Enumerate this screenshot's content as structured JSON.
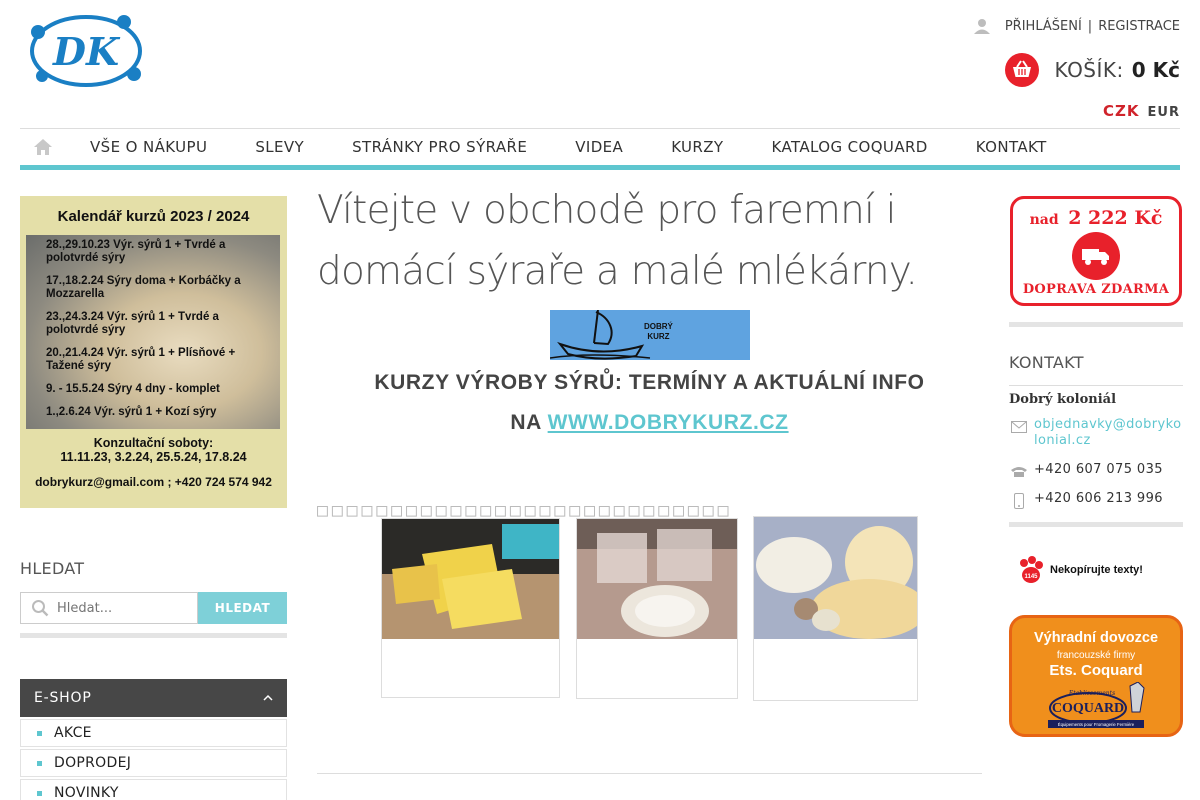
{
  "header": {
    "login": "PŘIHLÁŠENÍ",
    "register": "REGISTRACE",
    "cart_label": "KOŠÍK:",
    "cart_total": "0 Kč",
    "currency_active": "CZK",
    "currency_other": "EUR",
    "logo_text": "DK"
  },
  "nav": {
    "items": [
      "VŠE O NÁKUPU",
      "SLEVY",
      "STRÁNKY PRO SÝRAŘE",
      "VIDEA",
      "KURZY",
      "KATALOG COQUARD",
      "KONTAKT"
    ]
  },
  "calendar": {
    "title": "Kalendář kurzů 2023 / 2024",
    "lines": [
      "28.,29.10.23 Výr. sýrů 1 + Tvrdé a polotvrdé sýry",
      "17.,18.2.24 Sýry doma + Korbáčky a Mozzarella",
      "23.,24.3.24 Výr. sýrů 1 + Tvrdé a polotvrdé sýry",
      "20.,21.4.24 Výr. sýrů 1 + Plísňové + Tažené sýry",
      "9. - 15.5.24 Sýry 4 dny - komplet",
      "1.,2.6.24 Výr. sýrů 1 + Kozí sýry"
    ],
    "saturdays_title": "Konzultační soboty:",
    "saturdays_dates": "11.11.23, 3.2.24, 25.5.24, 17.8.24",
    "contact": "dobrykurz@gmail.com ; +420 724 574 942"
  },
  "search": {
    "heading": "HLEDAT",
    "placeholder": "Hledat...",
    "button": "HLEDAT"
  },
  "eshop": {
    "heading": "E-SHOP",
    "items": [
      "AKCE",
      "DOPRODEJ",
      "NOVINKY"
    ]
  },
  "main": {
    "welcome": "Vítejte v obchodě pro faremní i domácí sýraře a malé mlékárny.",
    "banner_text_1": "DOBRÝ",
    "banner_text_2": "KURZ",
    "kurzy_line1": "KURZY VÝROBY SÝRŮ: TERMÍNY A AKTUÁLNÍ INFO",
    "kurzy_line2_prefix": "NA",
    "kurzy_link": "WWW.DOBRYKURZ.CZ",
    "glyph_row": "□□□□□□□□□□□□□□□□□□□□□□□□□□□□"
  },
  "shipping": {
    "prefix": "nad",
    "amount": "2 222 Kč",
    "label": "DOPRAVA ZDARMA"
  },
  "contact": {
    "heading": "KONTAKT",
    "name": "Dobrý koloniál",
    "email": "objednavky@dobrykolonial.cz",
    "phone1": "+420 607 075 035",
    "phone2": "+420 606 213 996"
  },
  "nocopy": {
    "text": "Nekopírujte texty!",
    "badge": "1145"
  },
  "coquard": {
    "line1": "Výhradní dovozce",
    "line2": "francouzské firmy",
    "line3": "Ets. Coquard",
    "logo_small": "Etablissements",
    "logo_big": "COQUARD",
    "logo_tagline": "Équipements pour Fromagerie Fermière"
  },
  "colors": {
    "accent": "#5ec6cf",
    "red": "#e8212b",
    "orange": "#f08f1c"
  }
}
